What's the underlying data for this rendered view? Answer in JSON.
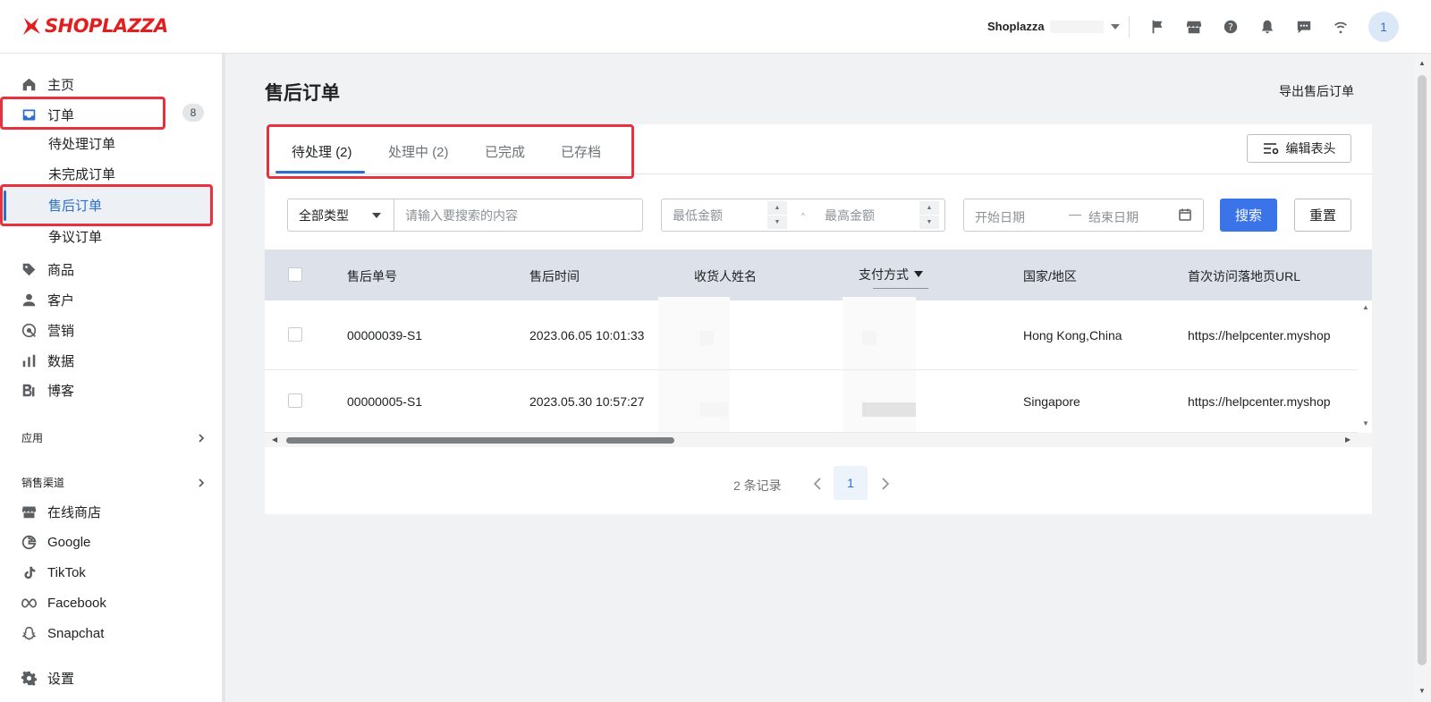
{
  "brand": {
    "name": "SHOPLAZZA",
    "color": "#e02020"
  },
  "header": {
    "store_name": "Shoplazza",
    "avatar": "1",
    "icons": [
      "flag-icon",
      "store-icon",
      "help-icon",
      "bell-icon",
      "chat-icon",
      "wifi-icon"
    ]
  },
  "sidebar": {
    "home": "主页",
    "orders": "订单",
    "orders_badge": "8",
    "orders_sub": [
      "待处理订单",
      "未完成订单",
      "售后订单",
      "争议订单"
    ],
    "products": "商品",
    "customers": "客户",
    "marketing": "营销",
    "analytics": "数据",
    "blog": "博客",
    "apps_title": "应用",
    "channels_title": "销售渠道",
    "channels": [
      "在线商店",
      "Google",
      "TikTok",
      "Facebook",
      "Snapchat"
    ],
    "settings": "设置"
  },
  "main": {
    "title": "售后订单",
    "export_label": "导出售后订单",
    "tabs": [
      {
        "label": "待处理",
        "count": "(2)"
      },
      {
        "label": "处理中",
        "count": "(2)"
      },
      {
        "label": "已完成",
        "count": ""
      },
      {
        "label": "已存档",
        "count": ""
      }
    ],
    "edit_header_label": "编辑表头",
    "filters": {
      "type_value": "全部类型",
      "search_placeholder": "请输入要搜索的内容",
      "min_amount_placeholder": "最低金额",
      "max_amount_placeholder": "最高金额",
      "start_date": "开始日期",
      "date_sep": "—",
      "end_date": "结束日期",
      "search_btn": "搜索",
      "reset_btn": "重置"
    },
    "table": {
      "columns": [
        "售后单号",
        "售后时间",
        "收货人姓名",
        "支付方式",
        "国家/地区",
        "首次访问落地页URL"
      ],
      "rows": [
        {
          "id": "00000039-S1",
          "time": "2023.06.05 10:01:33",
          "country": "Hong Kong,China",
          "url": "https://helpcenter.myshop"
        },
        {
          "id": "00000005-S1",
          "time": "2023.05.30 10:57:27",
          "country": "Singapore",
          "url": "https://helpcenter.myshop"
        }
      ]
    },
    "pagination": {
      "total_text": "2 条记录",
      "current_page": "1"
    }
  },
  "colors": {
    "accent": "#3b73e8",
    "highlight": "#e5323d"
  }
}
